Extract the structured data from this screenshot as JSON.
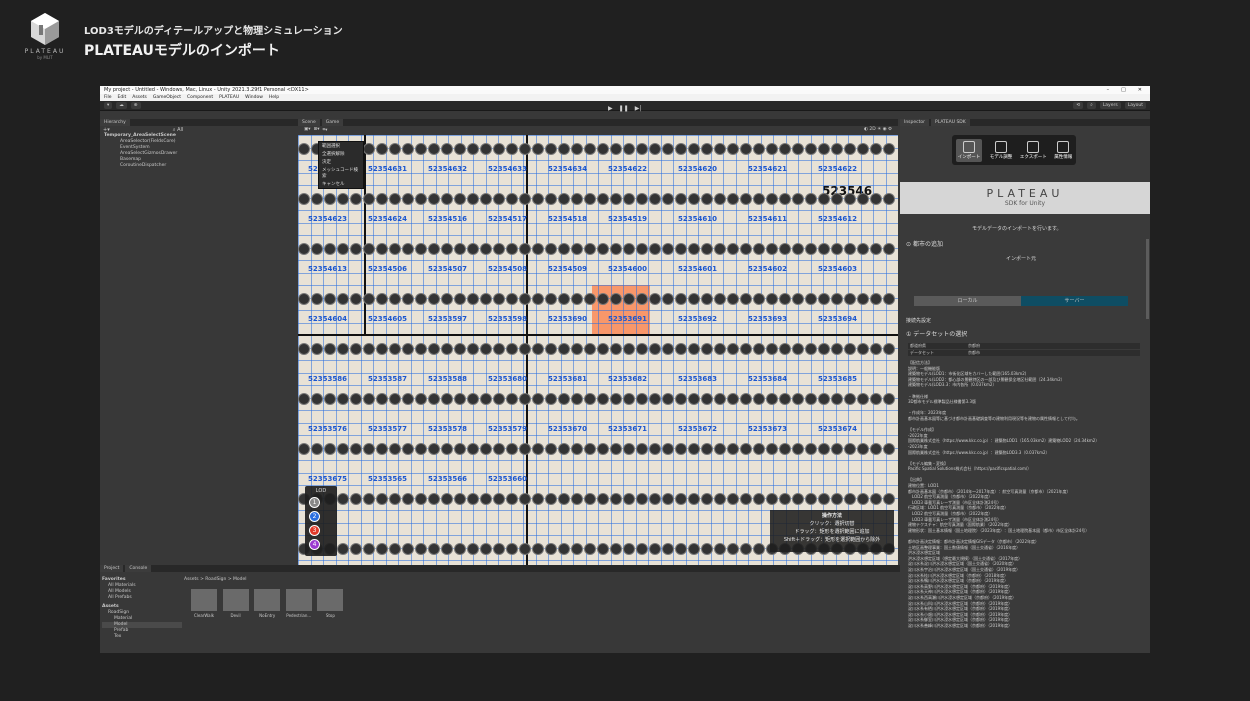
{
  "slide": {
    "logo_text": "PLATEAU",
    "logo_sub": "by MLIT",
    "subtitle": "LOD3モデルのディテールアップと物理シミュレーション",
    "title": "PLATEAUモデルのインポート"
  },
  "unity": {
    "window_title": "My project - Untitled - Windows, Mac, Linux - Unity 2021.3.29f1 Personal <DX11>",
    "menu": [
      "File",
      "Edit",
      "Assets",
      "GameObject",
      "Component",
      "PLATEAU",
      "Window",
      "Help"
    ],
    "layers_label": "Layers",
    "layout_label": "Layout",
    "hierarchy": {
      "tab": "Hierarchy",
      "items": [
        "Temporary_AreaSelectScene",
        "AreaSelector(FieldsCore)",
        "EventSystem",
        "AreaSelectGizmosDrawer",
        "Basemap",
        "CoroutineDispatcher"
      ]
    },
    "scene_tabs": [
      "Scene",
      "Game"
    ],
    "context_menu": [
      "範囲選択",
      "全選択解除",
      "決定",
      "メッシュコード検索",
      "キャンセル"
    ],
    "mesh_codes": [
      "5235462",
      "52354630",
      "52354631",
      "52354632",
      "52354633",
      "52354634",
      "52354622",
      "52354620",
      "52354621",
      "52354622",
      "52354623",
      "52354624",
      "52354516",
      "52354517",
      "52354518",
      "52354519",
      "52354610",
      "52354611",
      "52354612",
      "52354613",
      "52354506",
      "52354507",
      "52354508",
      "52354509",
      "52354600",
      "52354601",
      "52354602",
      "52354603",
      "52354604",
      "52354605",
      "52353597",
      "52353598",
      "52353690",
      "52353691",
      "52353692",
      "52353693",
      "52353694",
      "52353586",
      "52353587",
      "52353588",
      "52353680",
      "52353681",
      "52353682",
      "52353683",
      "52353684",
      "52353685",
      "52353576",
      "52353577",
      "52353578",
      "52353579",
      "52353670",
      "52353671",
      "52353672",
      "52353673",
      "52353674",
      "52353675",
      "52353565",
      "52353566",
      "52353660"
    ],
    "big_code": "523546",
    "lod": {
      "title": "LOD",
      "levels": [
        "1",
        "2",
        "3",
        "4"
      ]
    },
    "ops": {
      "title": "操作方法",
      "lines": [
        "クリック：選択切替",
        "ドラッグ：矩形を選択範囲に追加",
        "Shift＋ドラッグ：矩形を選択範囲から除外"
      ]
    },
    "inspector": {
      "tabs": [
        "Inspector",
        "PLATEAU SDK"
      ],
      "sdk_tabs": [
        "インポート",
        "モデル調整",
        "エクスポート",
        "属性情報"
      ],
      "logo": "PLATEAU",
      "logo_sub": "SDK for Unity",
      "intro": "モデルデータのインポートを行います。",
      "section_city": "都市の追加",
      "source_label": "インポート元",
      "source_local": "ローカル",
      "source_server": "サーバー",
      "conn_label": "接続先設定",
      "section_dataset": "データセットの選択",
      "dd1_label": "都道府県",
      "dd1_value": "京都府",
      "dd2_label": "データセット",
      "dd2_value": "京都市",
      "description": [
        "【配信方法】",
        "説明：一般機能版",
        "建築物モデル(LOD1：市街化区域をカバーした範囲(165.03km2)",
        "建築物モデル(LOD2：都心部の景観特区の一部及び景観保全地区社範囲（24.34km2）",
        "建築物モデル(LOD3.3：市内各所（0.037km2）",
        "",
        "・準拠仕様",
        "3D都市モデル標準製品仕様書第3.3版",
        "",
        "・作成年：2023年度",
        "都市計画基本図等に基づき都市計画基礎調査等の建物利用現況等を建物の属性情報として付与。",
        "",
        "【モデル作成】",
        "-2022年度",
        "国際航業株式会社（https://www.kkc.co.jp）：建築物LOD1（165.03km2）建築物LOD2（24.34km2）",
        "-2023年度",
        "国際航業株式会社（https://www.kkc.co.jp）：建築物LOD3.3（0.037km2）",
        "",
        "【モデル編集・変換】",
        "Pacific Spatial Solutions株式会社（https://pacificspatial.com/）",
        "",
        "【出典】",
        "建物位置：LOD1",
        "都市計画基本図（京都市）（2014年～2017年度）：航空写真測量（京都市）（2021年度）",
        "　LOD2 航空写真測量（京都市）（2022年度）",
        "　LOD3 車載写真レーザ測量（市区全体計測24号）",
        "行政区域：LOD1 航空写真測量（京都市）（2022年度）",
        "　LOD2 航空写真測量（京都市）（2022年度）",
        "　LOD3 車載写真レーザ測量（市区全体計測24号）",
        "建物テクスチャ：航空写真測量（国際航業）（2022年度）",
        "建物形状：国土基本情報（国土地理院）（2023年度）：国土地理院基本図（都市）市区全体計24号）",
        "",
        "都市計画決定情報：都市計画決定情報GISデータ（京都市）（2022年度）",
        "土地区画整理事業：国土数値情報（国土交通省）（2016年度）",
        "洪水浸水想定区域",
        "洪水浸水想定区域（想定最大規模）（国土交通省）（2017年度）",
        "淀川水系淀川洪水浸水想定区域（国土交通省）（2020年度）",
        "淀川水系宇治川洪水浸水想定区域（国土交通省）（2019年度）",
        "淀川水系桂川洪水浸水想定区域（京都府）（2018年度）",
        "淀川水系鴨川洪水浸水想定区域（京都府）（2019年度）",
        "淀川水系高野川洪水浸水想定区域（京都府）（2019年度）",
        "淀川水系天神川洪水浸水想定区域（京都府）（2019年度）",
        "淀川水系西高瀬川洪水浸水想定区域（京都府）（2019年度）",
        "淀川水系山科川洪水浸水想定区域（京都府）（2019年度）",
        "淀川水系有栖川洪水浸水想定区域（京都府）（2019年度）",
        "淀川水系小畑川洪水浸水想定区域（京都府）（2019年度）",
        "淀川水系御室川洪水浸水想定区域（京都府）（2019年度）",
        "淀川水系善峰川洪水浸水想定区域（京都府）（2019年度）"
      ]
    },
    "project": {
      "tabs": [
        "Project",
        "Console"
      ],
      "tree": [
        "Favorites",
        "All Materials",
        "All Models",
        "All Prefabs",
        "Assets",
        "RoadSign",
        "Material",
        "Model",
        "Prefab",
        "Tex"
      ],
      "breadcrumb": "Assets > RoadSign > Model",
      "assets": [
        "ClearWalk",
        "Devil",
        "NoEntry",
        "Pedestrian...",
        "Stop"
      ]
    }
  }
}
